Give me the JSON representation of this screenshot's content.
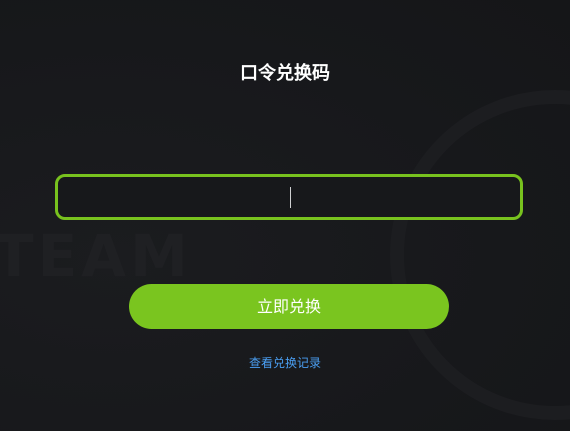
{
  "background": {
    "watermark_text": "TEAM"
  },
  "title": "口令兑换码",
  "code_input": {
    "value": "",
    "placeholder": ""
  },
  "redeem_button": {
    "label": "立即兑换"
  },
  "history_link": {
    "label": "查看兑换记录"
  },
  "colors": {
    "accent": "#78c21e",
    "link": "#4a9ff2",
    "background": "#17181b"
  }
}
